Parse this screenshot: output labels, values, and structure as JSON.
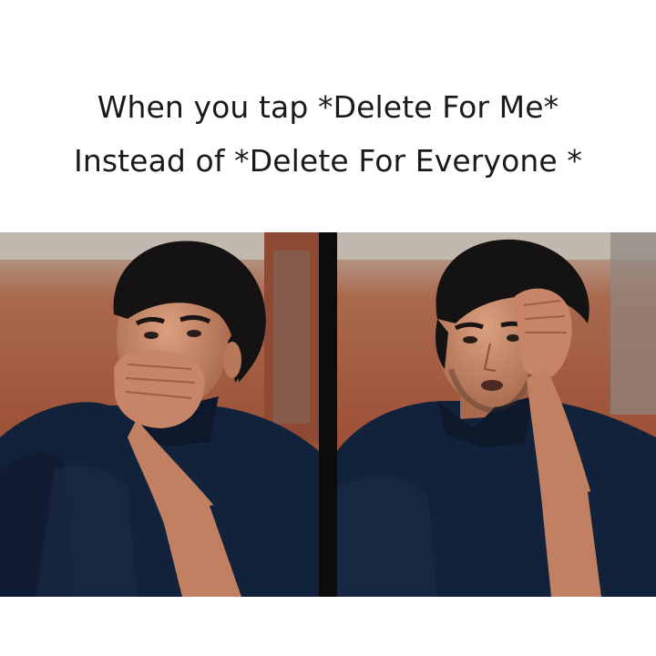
{
  "meme": {
    "caption_line_1": "When you tap *Delete For Me*",
    "caption_line_2": "Instead of *Delete For Everyone *"
  },
  "panels": [
    {
      "subject": "man-hand-over-mouth"
    },
    {
      "subject": "man-hand-on-forehead"
    }
  ],
  "colors": {
    "background": "#ffffff",
    "text": "#1a1a1a",
    "divider": "#0b0b0b",
    "shirt": "#12213a",
    "skin": "#c88a6a",
    "hair": "#141212",
    "wall": "#a25a3e"
  }
}
